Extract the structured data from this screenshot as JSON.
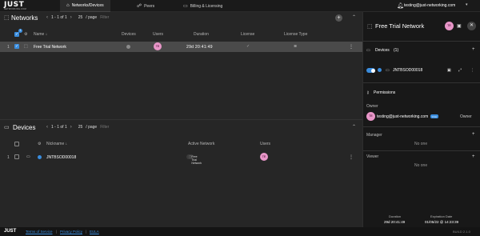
{
  "app": {
    "logo": "JUST",
    "logo_sub": "NETWORKING.COM",
    "user_email": "testing@just-networking.com",
    "user_initials": "TE",
    "build": "BUILD 2.1.0"
  },
  "nav": {
    "tabs": [
      {
        "label": "Networks/Devices",
        "icon": "network-icon",
        "active": true
      },
      {
        "label": "Peers",
        "icon": "peers-icon",
        "active": false
      },
      {
        "label": "Billing & Licensing",
        "icon": "billing-icon",
        "active": false
      }
    ]
  },
  "networks": {
    "title": "Networks",
    "pager_range": "1 - 1 of 1",
    "per_page": "25",
    "per_page_label": "/ page",
    "filter_placeholder": "Filter",
    "selected_badge": "1",
    "columns": [
      "Name",
      "Devices",
      "Users",
      "Duration",
      "License",
      "License Type"
    ],
    "rows": [
      {
        "index": "1",
        "name": "Free Trial Network",
        "duration": "29d 20:41:49"
      }
    ]
  },
  "devices": {
    "title": "Devices",
    "pager_range": "1 - 1 of 1",
    "per_page": "25",
    "per_page_label": "/ page",
    "filter_placeholder": "Filter",
    "columns": [
      "Nickname",
      "Active Network",
      "Users"
    ],
    "rows": [
      {
        "index": "1",
        "nickname": "JNTBSOD00018",
        "active_network": "Free Trial Network"
      }
    ]
  },
  "detail": {
    "title": "Free Trial Network",
    "devices_label": "Devices",
    "devices_count": "(1)",
    "device_name": "JNTBSOD00018",
    "permissions_label": "Permissions",
    "owner_label": "Owner",
    "owner_email": "testing@just-networking.com",
    "owner_pill": "YOU",
    "owner_role": "Owner",
    "manager_label": "Manager",
    "manager_empty": "No one",
    "viewer_label": "Viewer",
    "viewer_empty": "No one",
    "duration_label": "Duration",
    "duration_value": "29d 20:41:49",
    "expiration_label": "Expiration Date",
    "expiration_value": "01/05/22 @ 14:23:39"
  },
  "footer": {
    "terms": "Terms of Service",
    "privacy": "Privacy Policy",
    "eula": "EULA"
  },
  "colors": {
    "accent": "#3a8dde",
    "avatar": "#e896c8",
    "background": "#1f1f1f",
    "panel": "#262626",
    "selected_row": "#4a4a4a"
  }
}
